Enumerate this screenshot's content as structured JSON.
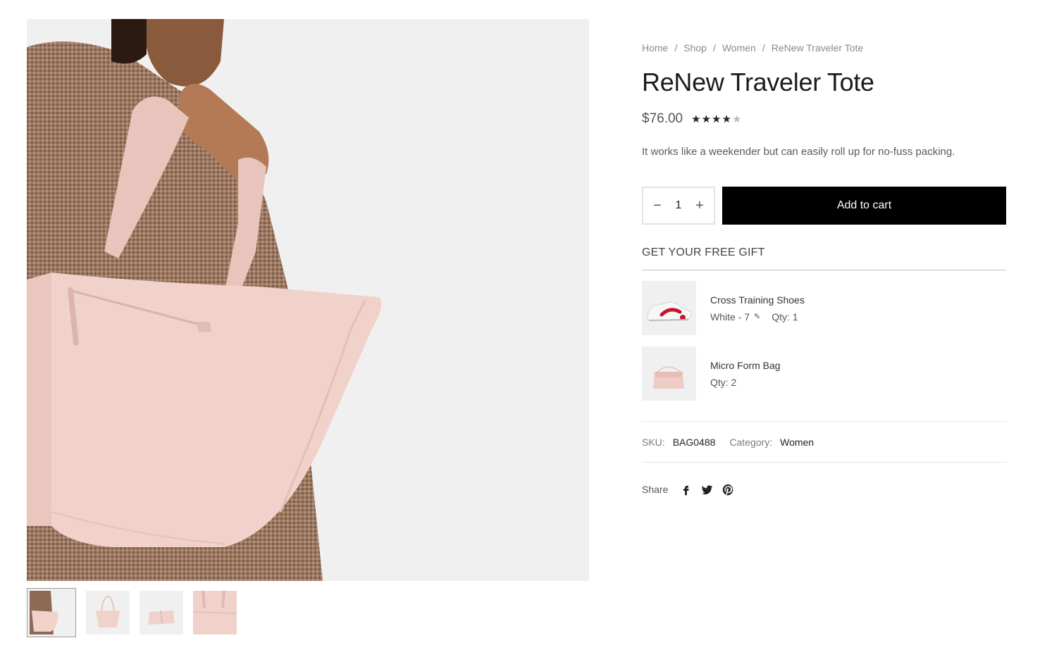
{
  "breadcrumb": {
    "items": [
      "Home",
      "Shop",
      "Women",
      "ReNew Traveler Tote"
    ],
    "separator": "/"
  },
  "product": {
    "title": "ReNew Traveler Tote",
    "price": "$76.00",
    "rating": 4.5,
    "rating_max": 5,
    "description": "It works like a weekender but can easily roll up for no-fuss packing."
  },
  "cart": {
    "quantity": "1",
    "minus_icon": "minus-icon",
    "plus_icon": "plus-icon",
    "add_label": "Add to cart"
  },
  "gift": {
    "heading": "GET YOUR FREE GIFT",
    "items": [
      {
        "name": "Cross Training Shoes",
        "variant": "White - 7",
        "qty": "Qty: 1",
        "image": "shoe-image",
        "editable": true
      },
      {
        "name": "Micro Form Bag",
        "variant": "",
        "qty": "Qty: 2",
        "image": "bag-image",
        "editable": false
      }
    ]
  },
  "meta": {
    "sku_label": "SKU:",
    "sku_value": "BAG0488",
    "category_label": "Category:",
    "category_value": "Women"
  },
  "share": {
    "label": "Share",
    "icons": [
      "facebook-icon",
      "twitter-icon",
      "pinterest-icon"
    ]
  },
  "gallery": {
    "thumbnails": [
      "model-with-tote",
      "tote-front",
      "tote-folded",
      "tote-detail"
    ],
    "active_index": 0
  },
  "colors": {
    "button_bg": "#000000",
    "image_bg": "#f1f0f0",
    "tote_pink": "#f0d2cb"
  }
}
